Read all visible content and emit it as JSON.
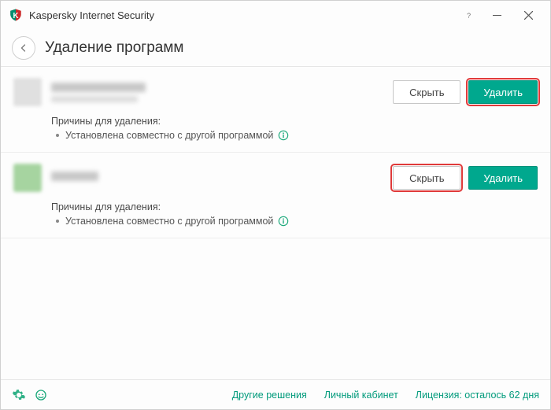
{
  "titlebar": {
    "app_title": "Kaspersky Internet Security"
  },
  "header": {
    "page_title": "Удаление программ"
  },
  "buttons": {
    "hide": "Скрыть",
    "delete": "Удалить"
  },
  "reasons_title": "Причины для удаления:",
  "reason_text": "Установлена совместно с другой программой",
  "items": [
    {
      "highlight_hide": false,
      "highlight_delete": true,
      "icon_green": false
    },
    {
      "highlight_hide": true,
      "highlight_delete": false,
      "icon_green": true
    }
  ],
  "footer": {
    "other_solutions": "Другие решения",
    "account": "Личный кабинет",
    "license": "Лицензия: осталось 62 дня"
  }
}
